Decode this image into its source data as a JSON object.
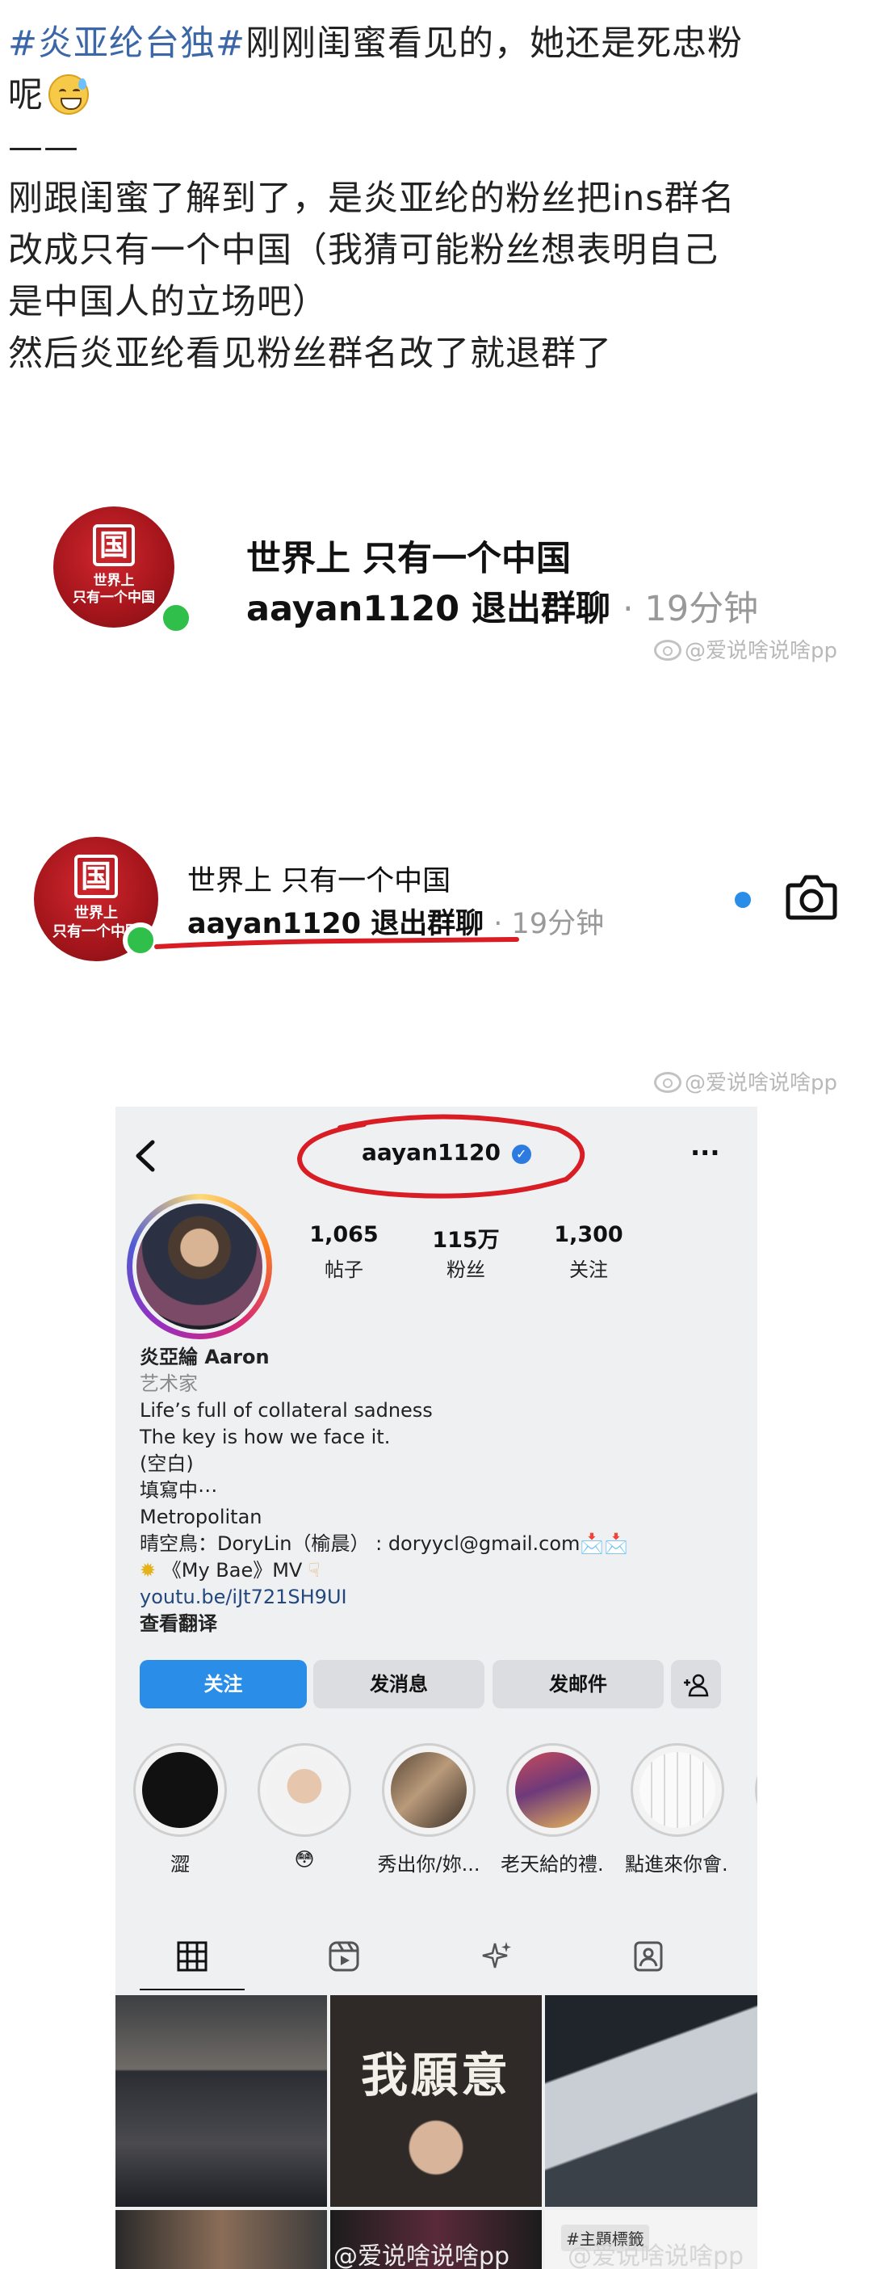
{
  "post": {
    "line1_tag": "#炎亚纶台独#",
    "line1_rest": "刚刚闺蜜看见的，她还是死忠粉",
    "line2": "呢",
    "divider": "——",
    "line3": "刚跟闺蜜了解到了，是炎亚纶的粉丝把ins群名",
    "line4": "改成只有一个中国（我猜可能粉丝想表明自己",
    "line5": "是中国人的立场吧）",
    "line6": "然后炎亚纶看见粉丝群名改了就退群了"
  },
  "chat1": {
    "avatar_seal": "国",
    "avatar_caption1": "世界上",
    "avatar_caption2": "只有一个中国",
    "title": "世界上 只有一个中国",
    "sub_user": "aayan1120 退出群聊",
    "sub_time": "· 19分钟",
    "watermark": "@爱说啥说啥pp"
  },
  "chat2": {
    "avatar_seal": "国",
    "avatar_caption1": "世界上",
    "avatar_caption2": "只有一个中国",
    "title": "世界上 只有一个中国",
    "sub_user": "aayan1120 退出群聊",
    "sub_time": "· 19分钟",
    "watermark": "@爱说啥说啥pp"
  },
  "instagram": {
    "back_icon": "chevron-left-icon",
    "username": "aayan1120",
    "more_label": "···",
    "stats": [
      {
        "value": "1,065",
        "label": "帖子"
      },
      {
        "value": "115万",
        "label": "粉丝"
      },
      {
        "value": "1,300",
        "label": "关注"
      }
    ],
    "display_name": "炎亞綸 Aaron",
    "category": "艺术家",
    "bio_lines": [
      "Life’s full of collateral sadness",
      "The key is how we face it.",
      "(空白)",
      "填寫中⋯",
      "Metropolitan",
      "晴空鳥：DoryLin（榆晨） : doryycl@gmail.com📩📩"
    ],
    "bio_mv": "《My Bae》MV",
    "bio_link": "youtu.be/iJt721SH9UI",
    "see_translation": "查看翻译",
    "follow_btn": "关注",
    "message_btn": "发消息",
    "email_btn": "发邮件",
    "add_user_icon": "add-person-icon",
    "highlights": [
      {
        "label": "澀"
      },
      {
        "label": "😳"
      },
      {
        "label": "秀出你/妳..."
      },
      {
        "label": "老天給的禮..."
      },
      {
        "label": "點進來你會..."
      }
    ],
    "grid_images": [
      {
        "caption": ""
      },
      {
        "caption": "我願意"
      },
      {
        "caption": ""
      },
      {
        "caption": ""
      },
      {
        "caption": ""
      },
      {
        "caption": "#主題標籤"
      }
    ],
    "bottom_watermark_left": "@爱说啥说啥pp",
    "bottom_watermark_right": "@爱说啥说啥pp"
  },
  "colors": {
    "ig_blue": "#2a8ee8",
    "red_annotation": "#d81d25",
    "online_green": "#2fbf4a",
    "verified_blue": "#2d7be0",
    "hashtag_blue": "#3b67a8"
  }
}
